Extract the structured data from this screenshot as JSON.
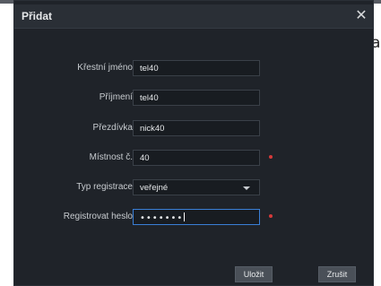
{
  "background": {
    "partial_char": "a"
  },
  "dialog": {
    "title": "Přidat",
    "close_symbol": "✕",
    "fields": {
      "first_name": {
        "label": "Křestní jméno",
        "value": "tel40"
      },
      "last_name": {
        "label": "Příjmení",
        "value": "tel40"
      },
      "nickname": {
        "label": "Přezdívka",
        "value": "nick40"
      },
      "room_number": {
        "label": "Místnost č.",
        "value": "40",
        "required": true
      },
      "registration_type": {
        "label": "Typ registrace",
        "value": "veřejné"
      },
      "registration_password": {
        "label": "Registrovat heslo",
        "value": "•••••••",
        "required": true
      }
    },
    "buttons": {
      "save": "Uložit",
      "cancel": "Zrušit"
    }
  },
  "colors": {
    "dialog_bg": "#1f2329",
    "titlebar_bg": "#2a2f36",
    "input_bg": "#181c21",
    "focus_border": "#3a7fd6",
    "required_marker": "#d63a3a",
    "button_bg": "#4a5058"
  }
}
